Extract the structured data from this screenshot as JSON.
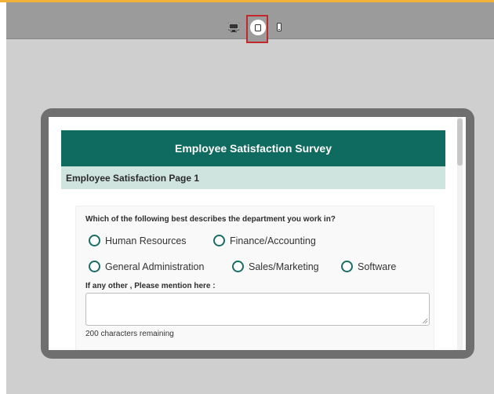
{
  "toolbar": {
    "devices": [
      {
        "name": "desktop",
        "icon": "desktop-icon",
        "selected": false
      },
      {
        "name": "tablet",
        "icon": "tablet-icon",
        "selected": true
      },
      {
        "name": "mobile",
        "icon": "mobile-icon",
        "selected": false
      }
    ],
    "accent": "#c0282d"
  },
  "survey": {
    "title": "Employee Satisfaction Survey",
    "page_title": "Employee Satisfaction Page 1",
    "header_color": "#0f6b5f",
    "question": {
      "text": "Which of the following best describes the department you work in?",
      "options": [
        "Human Resources",
        "Finance/Accounting",
        "General Administration",
        "Sales/Marketing",
        "Software"
      ],
      "other_label": "If any other , Please mention here :",
      "other_value": "",
      "chars_remaining": "200 characters remaining"
    }
  }
}
